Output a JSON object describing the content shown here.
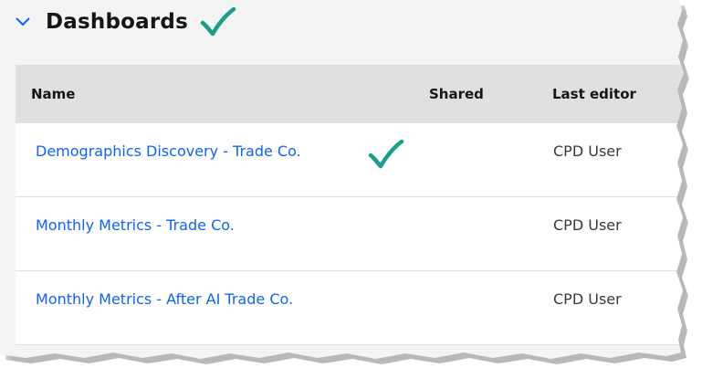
{
  "section": {
    "title": "Dashboards",
    "chevron_icon": "chevron-down-icon",
    "check_icon": "checkmark-icon"
  },
  "table": {
    "columns": [
      "Name",
      "Shared",
      "Last editor"
    ],
    "rows": [
      {
        "name": "Demographics Discovery - Trade Co.",
        "shared": "",
        "last_editor": "CPD User",
        "checked": true
      },
      {
        "name": "Monthly Metrics - Trade Co.",
        "shared": "",
        "last_editor": "CPD User",
        "checked": false
      },
      {
        "name": "Monthly Metrics - After AI Trade Co.",
        "shared": "",
        "last_editor": "CPD User",
        "checked": false
      }
    ]
  },
  "colors": {
    "link": "#0f62fe",
    "check": "#1a9e86",
    "header_bg": "#e0e0e0",
    "panel_bg": "#f4f4f4"
  }
}
